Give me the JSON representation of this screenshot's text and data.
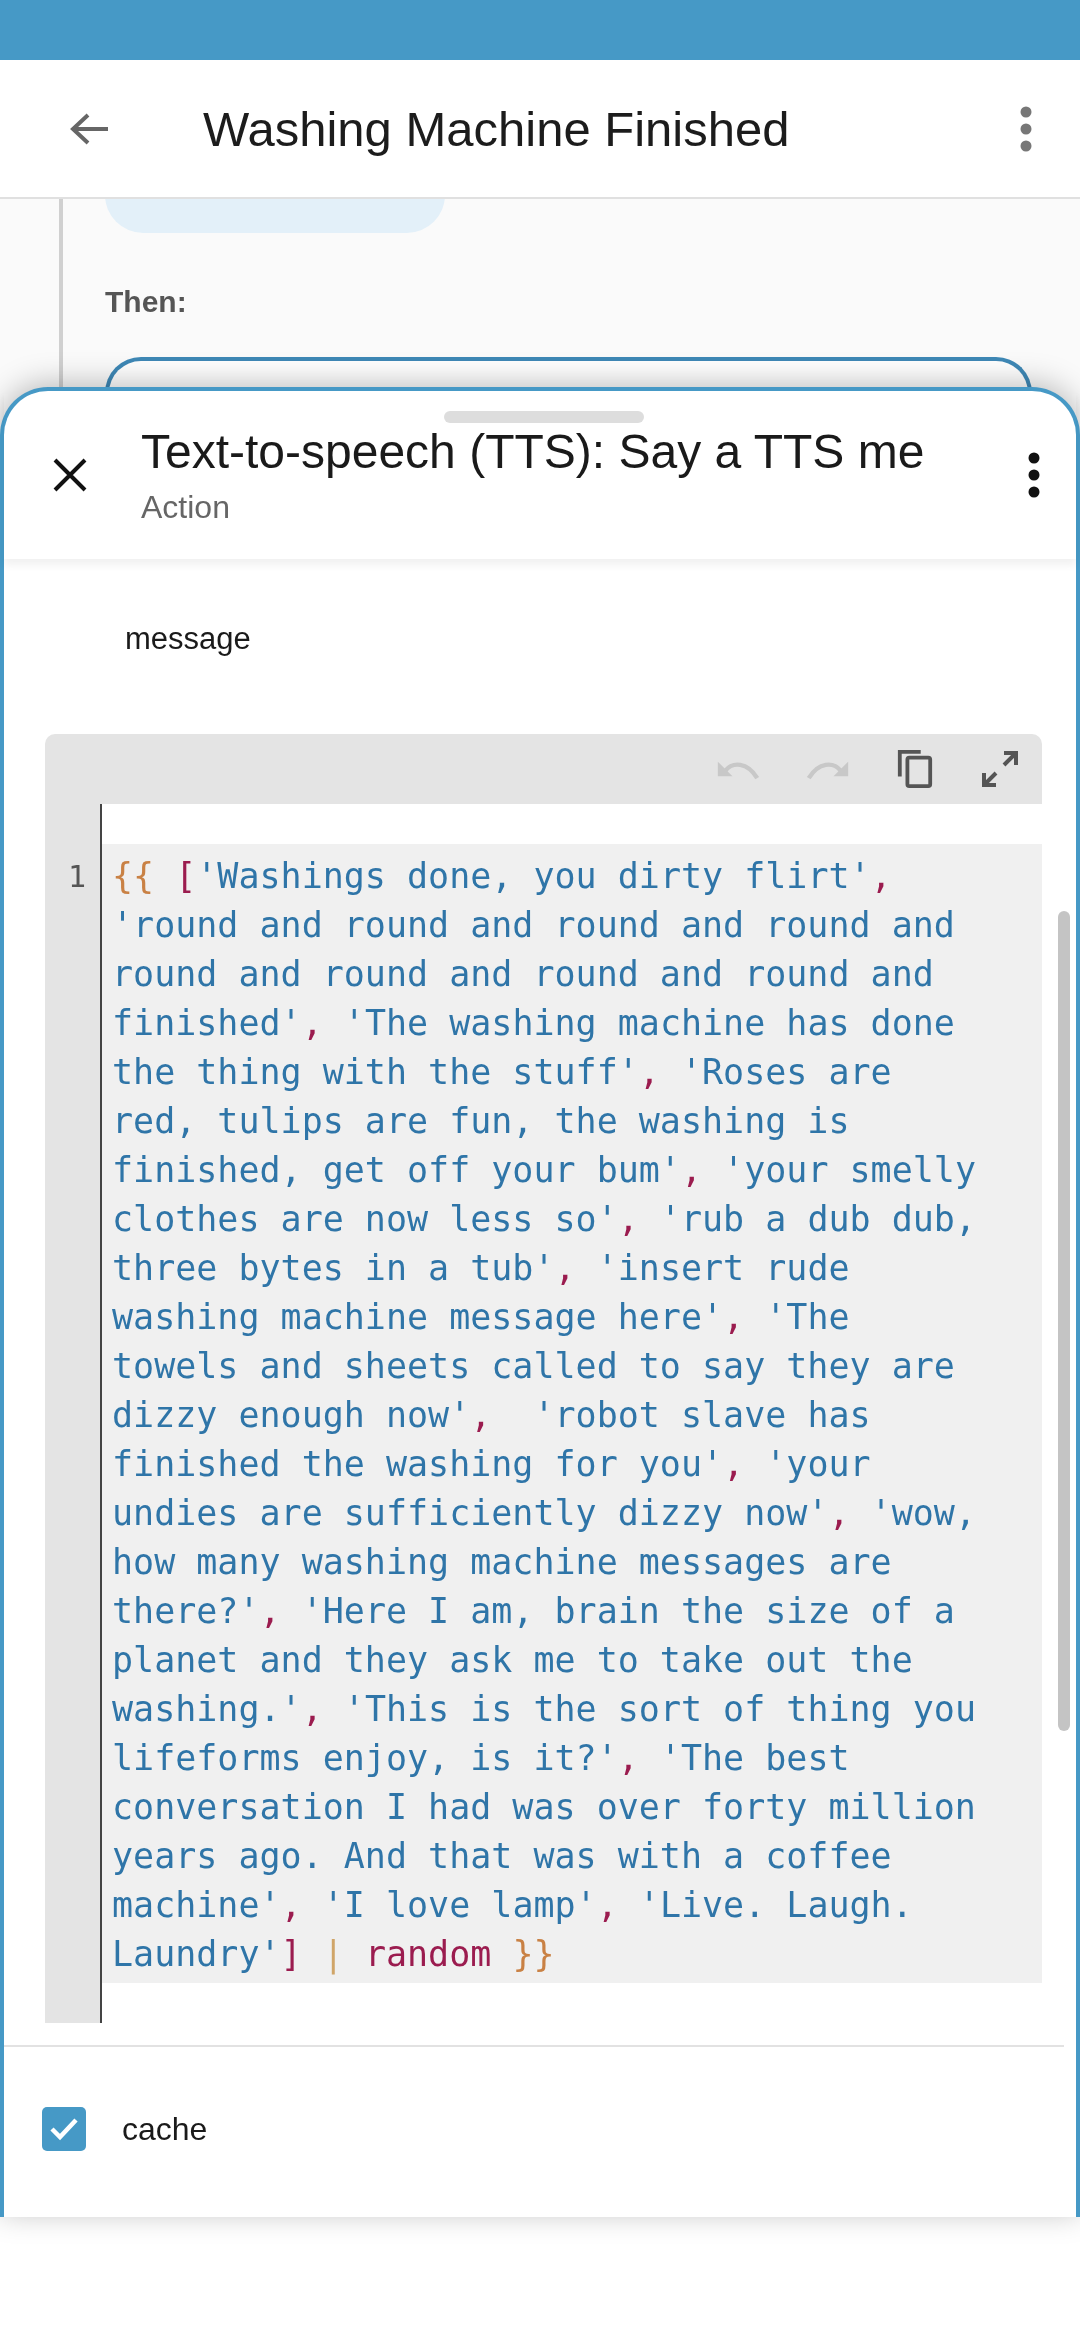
{
  "app_bar": {
    "title": "Washing Machine Finished"
  },
  "background": {
    "section_label": "Then:"
  },
  "sheet": {
    "title": "Text-to-speech (TTS): Say a TTS me",
    "subtitle": "Action"
  },
  "field_label": "message",
  "editor": {
    "tools": [
      {
        "kind": "undo",
        "disabled": true
      },
      {
        "kind": "redo",
        "disabled": true
      },
      {
        "kind": "copy",
        "disabled": false
      },
      {
        "kind": "expand",
        "disabled": false
      }
    ],
    "line_number": "1",
    "lines": [
      [
        {
          "kind": "brace",
          "text": "{{ "
        },
        {
          "kind": "punct",
          "text": "["
        },
        {
          "kind": "string",
          "text": "'Washings done, you dirty flirt'"
        },
        {
          "kind": "punct",
          "text": ","
        }
      ],
      [
        {
          "kind": "string",
          "text": "'round and round and round and round and"
        }
      ],
      [
        {
          "kind": "string",
          "text": "round and round and round and round and"
        }
      ],
      [
        {
          "kind": "string",
          "text": "finished'"
        },
        {
          "kind": "punct",
          "text": ", "
        },
        {
          "kind": "string",
          "text": "'The washing machine has done"
        }
      ],
      [
        {
          "kind": "string",
          "text": "the thing with the stuff'"
        },
        {
          "kind": "punct",
          "text": ", "
        },
        {
          "kind": "string",
          "text": "'Roses are"
        }
      ],
      [
        {
          "kind": "string",
          "text": "red, tulips are fun, the washing is"
        }
      ],
      [
        {
          "kind": "string",
          "text": "finished, get off your bum'"
        },
        {
          "kind": "punct",
          "text": ", "
        },
        {
          "kind": "string",
          "text": "'your smelly"
        }
      ],
      [
        {
          "kind": "string",
          "text": "clothes are now less so'"
        },
        {
          "kind": "punct",
          "text": ", "
        },
        {
          "kind": "string",
          "text": "'rub a dub dub,"
        }
      ],
      [
        {
          "kind": "string",
          "text": "three bytes in a tub'"
        },
        {
          "kind": "punct",
          "text": ", "
        },
        {
          "kind": "string",
          "text": "'insert rude"
        }
      ],
      [
        {
          "kind": "string",
          "text": "washing machine message here'"
        },
        {
          "kind": "punct",
          "text": ", "
        },
        {
          "kind": "string",
          "text": "'The"
        }
      ],
      [
        {
          "kind": "string",
          "text": "towels and sheets called to say they are"
        }
      ],
      [
        {
          "kind": "string",
          "text": "dizzy enough now'"
        },
        {
          "kind": "punct",
          "text": ",  "
        },
        {
          "kind": "string",
          "text": "'robot slave has"
        }
      ],
      [
        {
          "kind": "string",
          "text": "finished the washing for you'"
        },
        {
          "kind": "punct",
          "text": ", "
        },
        {
          "kind": "string",
          "text": "'your"
        }
      ],
      [
        {
          "kind": "string",
          "text": "undies are sufficiently dizzy now'"
        },
        {
          "kind": "punct",
          "text": ", "
        },
        {
          "kind": "string",
          "text": "'wow,"
        }
      ],
      [
        {
          "kind": "string",
          "text": "how many washing machine messages are"
        }
      ],
      [
        {
          "kind": "string",
          "text": "there?'"
        },
        {
          "kind": "punct",
          "text": ", "
        },
        {
          "kind": "string",
          "text": "'Here I am, brain the size of a"
        }
      ],
      [
        {
          "kind": "string",
          "text": "planet and they ask me to take out the"
        }
      ],
      [
        {
          "kind": "string",
          "text": "washing.'"
        },
        {
          "kind": "punct",
          "text": ", "
        },
        {
          "kind": "string",
          "text": "'This is the sort of thing you"
        }
      ],
      [
        {
          "kind": "string",
          "text": "lifeforms enjoy, is it?'"
        },
        {
          "kind": "punct",
          "text": ", "
        },
        {
          "kind": "string",
          "text": "'The best"
        }
      ],
      [
        {
          "kind": "string",
          "text": "conversation I had was over forty million"
        }
      ],
      [
        {
          "kind": "string",
          "text": "years ago. And that was with a coffee"
        }
      ],
      [
        {
          "kind": "string",
          "text": "machine'"
        },
        {
          "kind": "punct",
          "text": ", "
        },
        {
          "kind": "string",
          "text": "'I love lamp'"
        },
        {
          "kind": "punct",
          "text": ", "
        },
        {
          "kind": "string",
          "text": "'Live. Laugh."
        }
      ],
      [
        {
          "kind": "string",
          "text": "Laundry'"
        },
        {
          "kind": "punct",
          "text": "] "
        },
        {
          "kind": "pipe",
          "text": "| "
        },
        {
          "kind": "filter",
          "text": "random "
        },
        {
          "kind": "brace",
          "text": "}}"
        }
      ]
    ]
  },
  "options": [
    {
      "label": "cache",
      "checked": true
    }
  ]
}
